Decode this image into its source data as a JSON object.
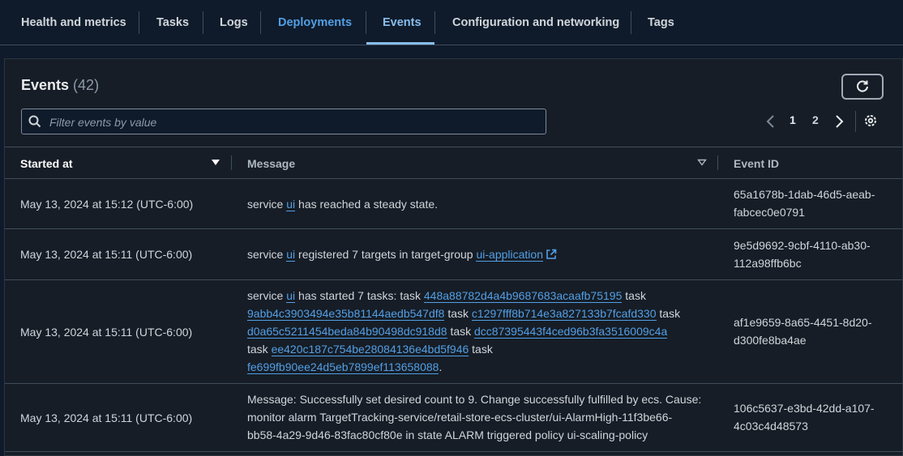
{
  "tabs": [
    {
      "label": "Health and metrics"
    },
    {
      "label": "Tasks"
    },
    {
      "label": "Logs"
    },
    {
      "label": "Deployments"
    },
    {
      "label": "Events"
    },
    {
      "label": "Configuration and networking"
    },
    {
      "label": "Tags"
    }
  ],
  "colors": {
    "accent": "#539fe5",
    "active_tab": "#89bdee",
    "background": "#0f1b2a",
    "panel": "#161d26"
  },
  "events": {
    "title": "Events",
    "count": "(42)",
    "refresh_icon": "refresh-icon",
    "search": {
      "placeholder": "Filter events by value",
      "value": ""
    },
    "pagination": {
      "current": "1",
      "other": "2"
    },
    "columns": {
      "started_at": "Started at",
      "message": "Message",
      "event_id": "Event ID"
    },
    "rows": [
      {
        "date": "May 13, 2024 at 15:12 (UTC-6:00)",
        "msg": {
          "p1": "service ",
          "link1": "ui",
          "p2": " has reached a steady state."
        },
        "id_l1": "65a1678b-1dab-46d5-aeab-",
        "id_l2": "fabcec0e0791"
      },
      {
        "date": "May 13, 2024 at 15:11 (UTC-6:00)",
        "msg": {
          "p1": "service ",
          "link1": "ui",
          "p2": " registered 7 targets in target-group ",
          "link2": "ui-application"
        },
        "id_l1": "9e5d9692-9cbf-4110-ab30-",
        "id_l2": "112a98ffb6bc"
      },
      {
        "date": "May 13, 2024 at 15:11 (UTC-6:00)",
        "msg": {
          "p1": "service ",
          "link1": "ui",
          "p2": " has started 7 tasks: task ",
          "t1": "448a88782d4a4b9687683acaafb75195",
          "t2": "9abb4c3903494e35b81144aedb547df8",
          "t3": "c1297fff8b714e3a827133b7fcafd330",
          "t4": "d0a65c5211454beda84b90498dc918d8",
          "t5": "dcc87395443f4ced96b3fa3516009c4a",
          "t6": "ee420c187c754be28084136e4bd5f946",
          "t7": "fe699fb90ee24d5eb7899ef113658088",
          "task_word": "task",
          "end": "."
        },
        "id_l1": "af1e9659-8a65-4451-8d20-",
        "id_l2": "d300fe8ba4ae"
      },
      {
        "date": "May 13, 2024 at 15:11 (UTC-6:00)",
        "msg": {
          "l1": "Message: Successfully set desired count to 9. Change successfully fulfilled by ecs. Cause:",
          "l2": "monitor alarm TargetTracking-service/retail-store-ecs-cluster/ui-AlarmHigh-11f3be66-",
          "l3": "bb58-4a29-9d46-83fac80cf80e in state ALARM triggered policy ui-scaling-policy"
        },
        "id_l1": "106c5637-e3bd-42dd-a107-",
        "id_l2": "4c03c4d48573"
      }
    ]
  }
}
